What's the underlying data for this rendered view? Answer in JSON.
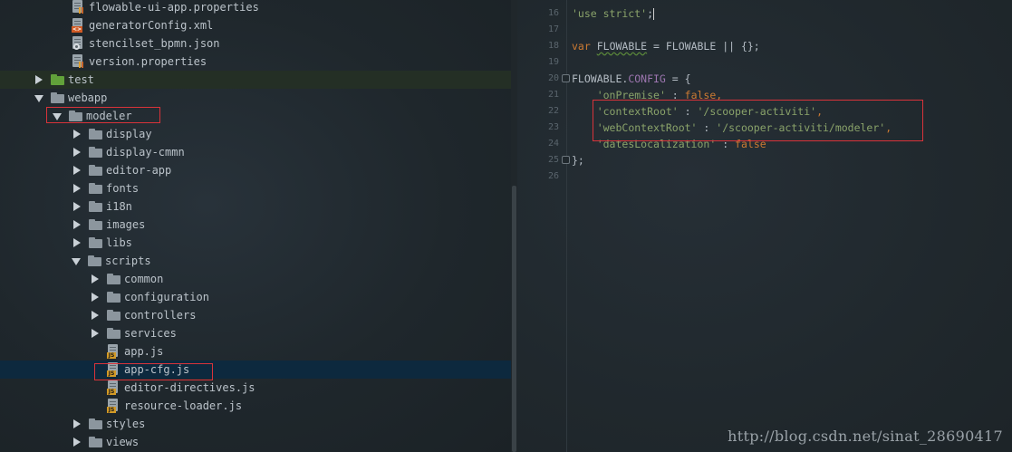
{
  "tree": {
    "items": [
      {
        "label": "flowable-ui-app.properties",
        "kind": "file",
        "icon": "properties-file-icon"
      },
      {
        "label": "generatorConfig.xml",
        "kind": "file",
        "icon": "xml-file-icon"
      },
      {
        "label": "stencilset_bpmn.json",
        "kind": "file",
        "icon": "json-file-icon"
      },
      {
        "label": "version.properties",
        "kind": "file",
        "icon": "properties-file-icon"
      },
      {
        "label": "test",
        "kind": "folder",
        "icon": "test-folder-icon"
      },
      {
        "label": "webapp",
        "kind": "folder",
        "icon": "folder-icon"
      },
      {
        "label": "modeler",
        "kind": "folder",
        "icon": "folder-icon"
      },
      {
        "label": "display",
        "kind": "folder",
        "icon": "folder-icon"
      },
      {
        "label": "display-cmmn",
        "kind": "folder",
        "icon": "folder-icon"
      },
      {
        "label": "editor-app",
        "kind": "folder",
        "icon": "folder-icon"
      },
      {
        "label": "fonts",
        "kind": "folder",
        "icon": "folder-icon"
      },
      {
        "label": "i18n",
        "kind": "folder",
        "icon": "folder-icon"
      },
      {
        "label": "images",
        "kind": "folder",
        "icon": "folder-icon"
      },
      {
        "label": "libs",
        "kind": "folder",
        "icon": "folder-icon"
      },
      {
        "label": "scripts",
        "kind": "folder",
        "icon": "folder-icon"
      },
      {
        "label": "common",
        "kind": "folder",
        "icon": "folder-icon"
      },
      {
        "label": "configuration",
        "kind": "folder",
        "icon": "folder-icon"
      },
      {
        "label": "controllers",
        "kind": "folder",
        "icon": "folder-icon"
      },
      {
        "label": "services",
        "kind": "folder",
        "icon": "folder-icon"
      },
      {
        "label": "app.js",
        "kind": "file",
        "icon": "js-file-icon"
      },
      {
        "label": "app-cfg.js",
        "kind": "file",
        "icon": "js-file-icon"
      },
      {
        "label": "editor-directives.js",
        "kind": "file",
        "icon": "js-file-icon"
      },
      {
        "label": "resource-loader.js",
        "kind": "file",
        "icon": "js-file-icon"
      },
      {
        "label": "styles",
        "kind": "folder",
        "icon": "folder-icon"
      },
      {
        "label": "views",
        "kind": "folder",
        "icon": "folder-icon"
      }
    ],
    "selected_item": "app-cfg.js"
  },
  "editor": {
    "line_numbers": [
      "16",
      "17",
      "18",
      "19",
      "20",
      "21",
      "22",
      "23",
      "24",
      "25",
      "26"
    ],
    "code": {
      "l16_str": "'use strict'",
      "l16_semi": ";",
      "l18_var": "var",
      "l18_name": "FLOWABLE",
      "l18_rest": " = FLOWABLE || {};",
      "l20_obj": "FLOWABLE.",
      "l20_prop": "CONFIG",
      "l20_rest": " = {",
      "l21_key": "'onPremise'",
      "l21_colon": " : ",
      "l21_val": "false",
      "l21_end": ",",
      "l22_key": "'contextRoot'",
      "l22_colon": " : ",
      "l22_val": "'/scooper-activiti'",
      "l22_end": ",",
      "l23_key": "'webContextRoot'",
      "l23_colon": " : ",
      "l23_val": "'/scooper-activiti/modeler'",
      "l23_end": ",",
      "l24_key": "'datesLocalization'",
      "l24_colon": " : ",
      "l24_val": "false",
      "l25": "};"
    }
  },
  "watermark": "http://blog.csdn.net/sinat_28690417",
  "colors": {
    "highlight_box": "#d8333a",
    "selection": "#0d293e",
    "string": "#8aa36a",
    "keyword": "#cc7a32",
    "property": "#9d76b0"
  }
}
